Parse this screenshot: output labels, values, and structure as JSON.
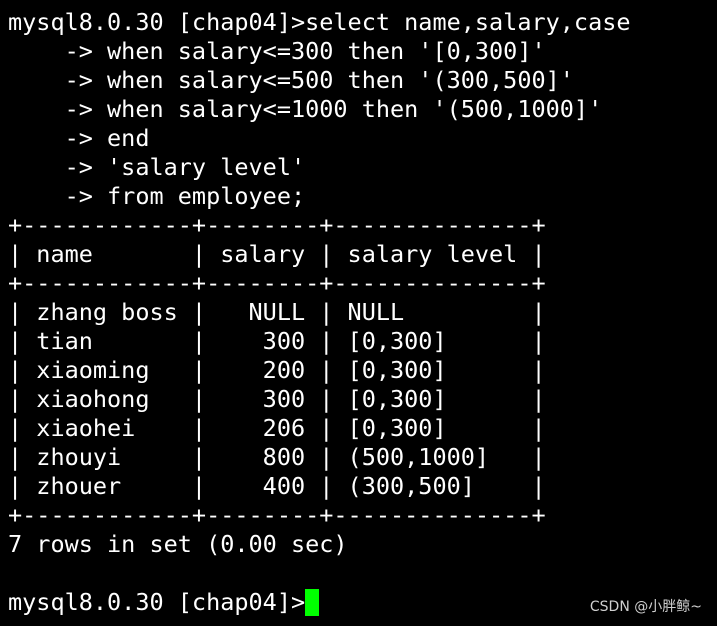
{
  "terminal": {
    "background_color": "#000000",
    "text_color": "#ffffff",
    "cursor_color": "#00ff00",
    "lines": [
      "mysql8.0.30 [chap04]>select name,salary,case",
      "    -> when salary<=300 then '[0,300]'",
      "    -> when salary<=500 then '(300,500]'",
      "    -> when salary<=1000 then '(500,1000]'",
      "    -> end",
      "    -> 'salary level'",
      "    -> from employee;",
      "+------------+--------+--------------+",
      "| name       | salary | salary level |",
      "+------------+--------+--------------+",
      "| zhang boss |   NULL | NULL         |",
      "| tian       |    300 | [0,300]      |",
      "| xiaoming   |    200 | [0,300]      |",
      "| xiaohong   |    300 | [0,300]      |",
      "| xiaohei    |    206 | [0,300]      |",
      "| zhouyi     |    800 | (500,1000]   |",
      "| zhouer     |    400 | (300,500]    |",
      "+------------+--------+--------------+",
      "7 rows in set (0.00 sec)",
      ""
    ],
    "prompt": "mysql8.0.30 [chap04]>"
  },
  "watermark": "CSDN @小胖鲸~"
}
